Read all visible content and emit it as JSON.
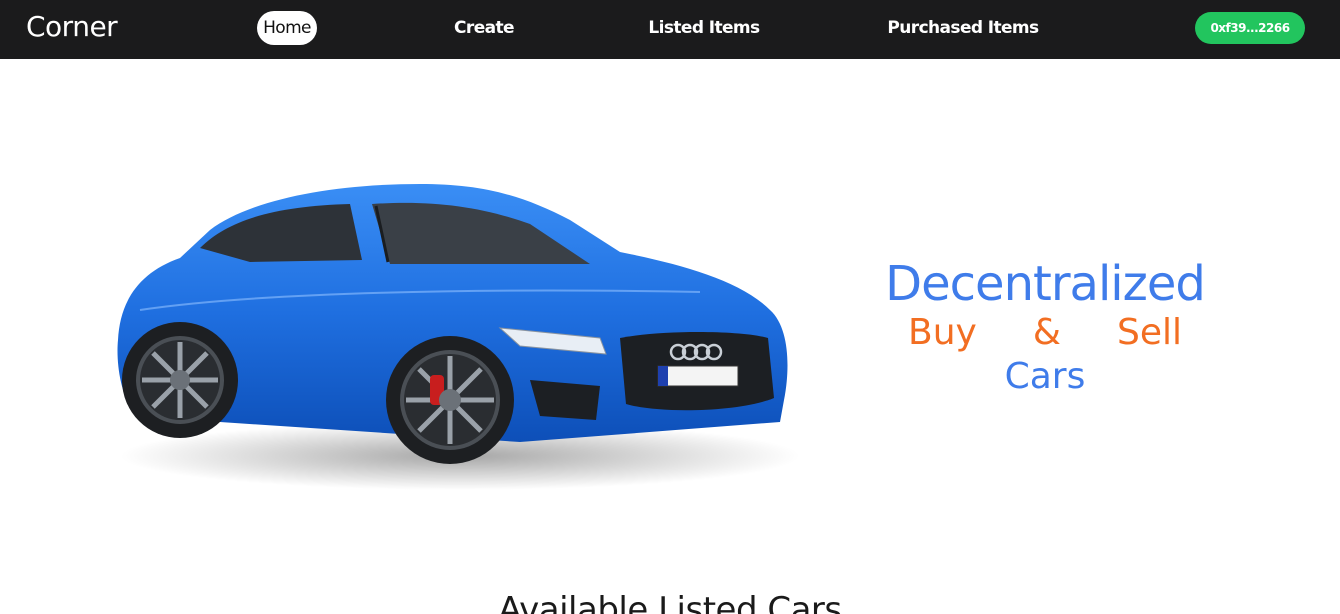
{
  "navbar": {
    "brand": "Corner",
    "links": [
      {
        "label": "Home",
        "active": true
      },
      {
        "label": "Create",
        "active": false
      },
      {
        "label": "Listed Items",
        "active": false
      },
      {
        "label": "Purchased Items",
        "active": false
      }
    ],
    "wallet_address": "0xf39...2266"
  },
  "hero": {
    "title": "Decentralized",
    "sub_words": [
      "Buy",
      "&",
      "Sell"
    ],
    "last_line": "Cars",
    "image_icon": "car-icon"
  },
  "section": {
    "title": "Available Listed Cars"
  },
  "colors": {
    "navbar_bg": "#1b1b1c",
    "accent_blue": "#3f7cea",
    "accent_orange": "#f26e22",
    "wallet_green": "#22c55e",
    "car_blue": "#1f6fe0"
  }
}
